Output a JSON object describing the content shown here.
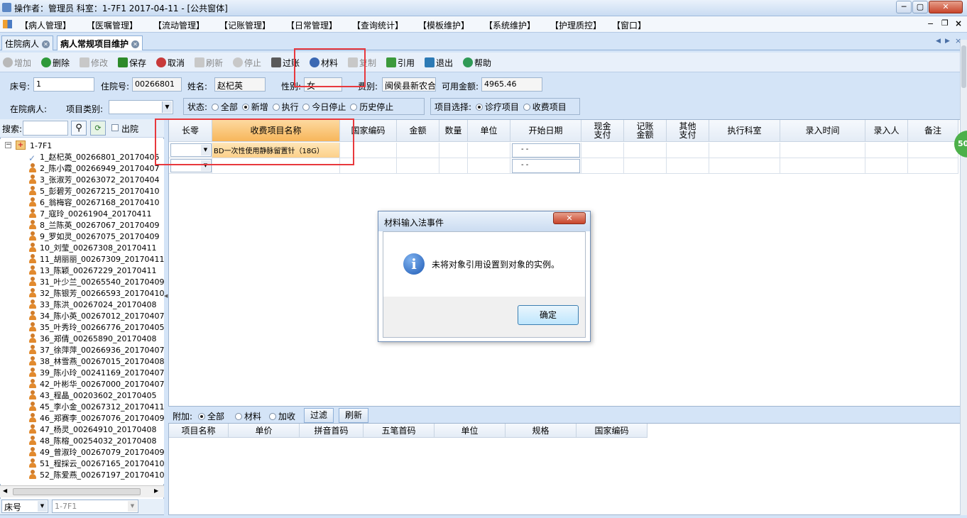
{
  "window": {
    "title": "操作者：管理员  科室：1-7F1  2017-04-11 - [公共窗体]"
  },
  "menu": [
    "【病人管理】",
    "【医嘱管理】",
    "【流动管理】",
    "【记账管理】",
    "【日常管理】",
    "【查询统计】",
    "【模板维护】",
    "【系统维护】",
    "【护理质控】",
    "【窗口】"
  ],
  "tabs": [
    {
      "label": "住院病人"
    },
    {
      "label": "病人常规项目维护"
    }
  ],
  "toolbar": [
    "增加",
    "删除",
    "修改",
    "保存",
    "取消",
    "刷新",
    "停止",
    "过账",
    "材料",
    "复制",
    "引用",
    "退出",
    "帮助"
  ],
  "patient": {
    "bed_label": "床号:",
    "bed": "1",
    "inpatient_no_label": "住院号:",
    "inpatient_no": "00266801",
    "name_label": "姓名:",
    "name": "赵杞英",
    "sex_label": "性别:",
    "sex": "女",
    "fee_type_label": "费别:",
    "fee_type": "闽侯县新农合",
    "available_label": "可用金额:",
    "available": "4965.46"
  },
  "filters": {
    "inpatient_label": "在院病人:",
    "item_type_label": "项目类别:",
    "status_label": "状态:",
    "status_options": [
      "全部",
      "新增",
      "执行",
      "今日停止",
      "历史停止"
    ],
    "status_selected": "新增",
    "item_select_label": "项目选择:",
    "item_options": [
      "诊疗项目",
      "收费项目"
    ],
    "item_selected": "诊疗项目"
  },
  "search": {
    "label": "搜索:",
    "inhospital": "出院"
  },
  "tree": {
    "root": "1-7F1",
    "patients": [
      "1_赵杞英_00266801_20170405",
      "2_陈小霞_00266949_20170407",
      "3_张淑芳_00263072_20170404",
      "5_彭碧芳_00267215_20170410",
      "6_翁梅容_00267168_20170410",
      "7_寇玲_00261904_20170411",
      "8_兰陈英_00267067_20170409",
      "9_罗如灵_00267075_20170409",
      "10_刘莹_00267308_20170411",
      "11_胡丽丽_00267309_20170411",
      "13_陈颖_00267229_20170411",
      "31_叶少兰_00265540_20170409",
      "32_陈银芳_00266593_20170410",
      "33_陈洪_00267024_20170408",
      "34_陈小英_00267012_20170407",
      "35_叶秀玲_00266776_20170405",
      "36_郑倩_00265890_20170408",
      "37_徐萍萍_00266936_20170407",
      "38_林雪燕_00267015_20170408",
      "39_陈小玲_00241169_20170407",
      "42_叶彬华_00267000_20170407",
      "43_程晶_00203602_20170405",
      "45_李小金_00267312_20170411",
      "46_郑赛李_00267076_20170409",
      "47_杨灵_00264910_20170408",
      "48_陈榕_00254032_20170408",
      "49_曾淑玲_00267079_20170409",
      "51_程採云_00267165_20170410",
      "52_陈爱燕_00267197_20170410"
    ]
  },
  "bottom_left": {
    "combo1": "床号",
    "combo2": "1-7F1"
  },
  "grid": {
    "columns": [
      "长零",
      "收费项目名称",
      "国家编码",
      "金额",
      "数量",
      "单位",
      "开始日期",
      "现金\n支付",
      "记账\n金额",
      "其他\n支付",
      "执行科室",
      "录入时间",
      "录入人",
      "备注"
    ],
    "row1_item": "BD一次性使用静脉留置针（18G）",
    "date_placeholder": "-   -"
  },
  "addbar": {
    "label": "附加:",
    "options": [
      "全部",
      "材料",
      "加收"
    ],
    "selected": "全部",
    "filter": "过滤",
    "refresh": "刷新"
  },
  "grid2": {
    "columns": [
      "项目名称",
      "单价",
      "拼音首码",
      "五笔首码",
      "单位",
      "规格",
      "国家编码"
    ]
  },
  "dialog": {
    "title": "材料输入法事件",
    "message": "未将对象引用设置到对象的实例。",
    "ok": "确定"
  },
  "badge": "50"
}
